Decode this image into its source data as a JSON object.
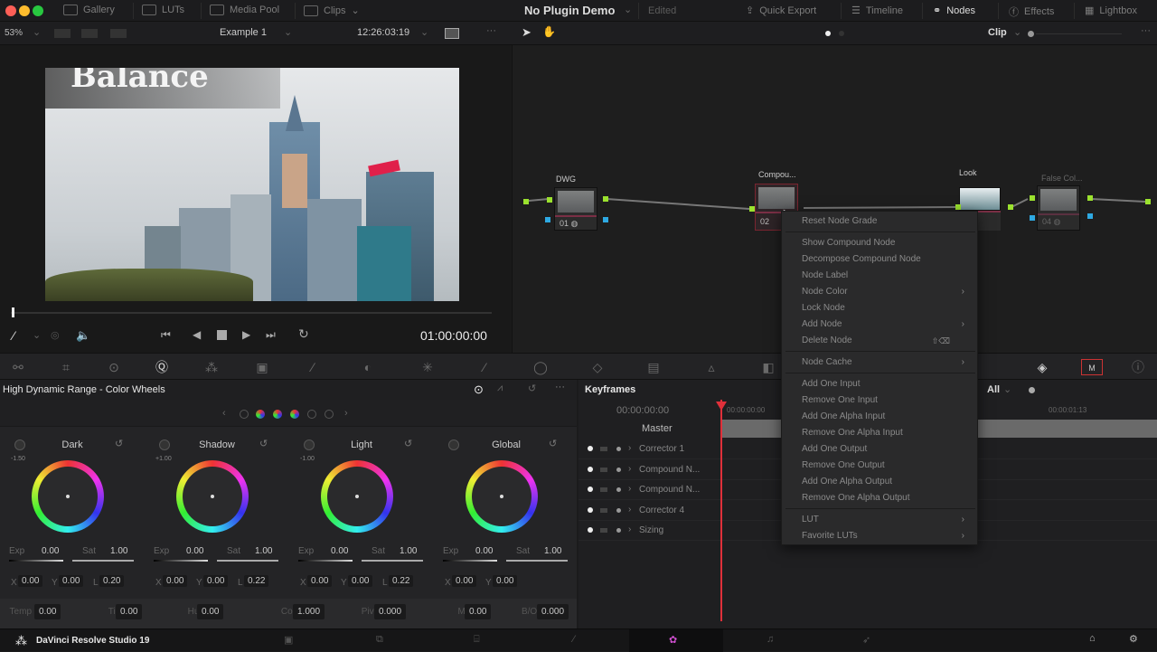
{
  "topbar": {
    "gallery": "Gallery",
    "luts": "LUTs",
    "media_pool": "Media Pool",
    "clips": "Clips",
    "project_title": "No Plugin Demo",
    "status": "Edited",
    "quick_export": "Quick Export",
    "timeline": "Timeline",
    "nodes": "Nodes",
    "effects": "Effects",
    "lightbox": "Lightbox"
  },
  "viewer_bar": {
    "zoom": "53%",
    "timeline_name": "Example 1",
    "source_timecode": "12:26:03:19",
    "node_mode": "Clip"
  },
  "viewer": {
    "frame_title": "Balance",
    "timecode": "01:00:00:00",
    "playhead_progress": 0
  },
  "node_graph": {
    "nodes": [
      {
        "label": "DWG",
        "number": "01"
      },
      {
        "label": "Compou...",
        "number": "02"
      },
      {
        "label": "Look",
        "number": ""
      },
      {
        "label": "False Col...",
        "number": "04"
      }
    ],
    "tooltip": "Reset Node Grade"
  },
  "context_menu": {
    "items": [
      {
        "label": "Reset Node Grade"
      },
      {
        "label": "Show Compound Node"
      },
      {
        "label": "Decompose Compound Node"
      },
      {
        "label": "Node Label"
      },
      {
        "label": "Node Color",
        "submenu": true
      },
      {
        "label": "Lock Node"
      },
      {
        "label": "Add Node",
        "submenu": true
      },
      {
        "label": "Delete Node",
        "shortcut": "⇧⌫"
      },
      {
        "label": "Node Cache",
        "submenu": true
      },
      {
        "label": "Add One Input"
      },
      {
        "label": "Remove One Input"
      },
      {
        "label": "Add One Alpha Input"
      },
      {
        "label": "Remove One Alpha Input"
      },
      {
        "label": "Add One Output"
      },
      {
        "label": "Remove One Output"
      },
      {
        "label": "Add One Alpha Output"
      },
      {
        "label": "Remove One Alpha Output"
      },
      {
        "label": "LUT",
        "submenu": true
      },
      {
        "label": "Favorite LUTs",
        "submenu": true
      }
    ]
  },
  "color_wheels": {
    "title": "High Dynamic Range - Color Wheels",
    "wheels": [
      {
        "name": "Dark",
        "zone": "-1.50",
        "exp": "0.00",
        "sat": "1.00",
        "x": "0.00",
        "y": "0.00",
        "l": "0.20"
      },
      {
        "name": "Shadow",
        "zone": "+1.00",
        "exp": "0.00",
        "sat": "1.00",
        "x": "0.00",
        "y": "0.00",
        "l": "0.22"
      },
      {
        "name": "Light",
        "zone": "-1.00",
        "exp": "0.00",
        "sat": "1.00",
        "x": "0.00",
        "y": "0.00",
        "l": "0.22"
      },
      {
        "name": "Global",
        "zone": "",
        "exp": "0.00",
        "sat": "1.00",
        "x": "0.00",
        "y": "0.00",
        "l": ""
      }
    ],
    "labels": {
      "exp": "Exp",
      "sat": "Sat",
      "x": "X",
      "y": "Y",
      "l": "L"
    },
    "bottom": [
      {
        "label": "Temp",
        "value": "0.00"
      },
      {
        "label": "Tint",
        "value": "0.00"
      },
      {
        "label": "Hue",
        "value": "0.00"
      },
      {
        "label": "Cont",
        "value": "1.000"
      },
      {
        "label": "Pivot",
        "value": "0.000"
      },
      {
        "label": "MD",
        "value": "0.00"
      },
      {
        "label": "B/Ofs",
        "value": "0.000"
      }
    ]
  },
  "keyframes": {
    "title": "Keyframes",
    "filter": "All",
    "timecode": "00:00:00:00",
    "ruler_start": "00:00:00:00",
    "ruler_mark": "00:00:01:13",
    "master": "Master",
    "tracks": [
      "Corrector 1",
      "Compound N...",
      "Compound N...",
      "Corrector 4",
      "Sizing"
    ]
  },
  "bottom_bar": {
    "app_name": "DaVinci Resolve Studio 19"
  },
  "colors": {
    "accent_red": "#e0303a",
    "port_green": "#9be22e",
    "port_blue": "#2ea9e2"
  }
}
